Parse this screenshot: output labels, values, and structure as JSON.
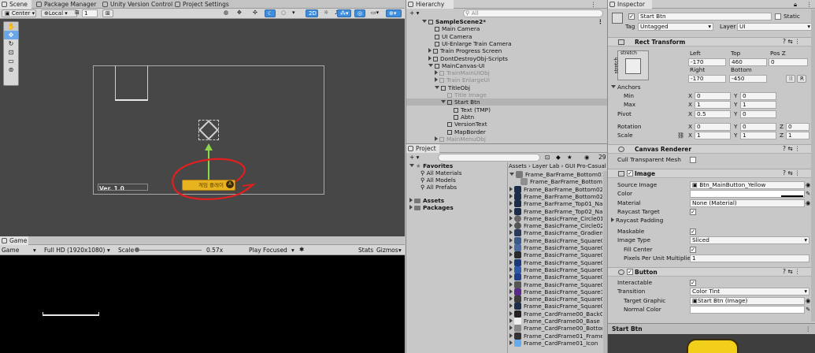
{
  "scene_tabs": {
    "scene": "Scene",
    "package_manager": "Package Manager",
    "unity_version_control": "Unity Version Control",
    "project_settings": "Project Settings"
  },
  "scene_toolbar": {
    "pivot": "Center",
    "space": "Local",
    "snap_value": "1",
    "mode_2d": "2D"
  },
  "scene_view": {
    "version_label": "Ver. 1.0",
    "button_text": "게임 플레이"
  },
  "game_tab": {
    "label": "Game",
    "display": "Game",
    "resolution": "Full HD (1920x1080)",
    "scale_label": "Scale",
    "scale_value": "0.57x",
    "play_mode": "Play Focused",
    "stats": "Stats",
    "gizmos": "Gizmos"
  },
  "hierarchy": {
    "title": "Hierarchy",
    "search_placeholder": "All",
    "items": [
      {
        "label": "SampleScene2*",
        "level": 0,
        "bold": true,
        "arrow": "down",
        "faded": false,
        "selected": false
      },
      {
        "label": "Main Camera",
        "level": 1,
        "arrow": "",
        "faded": false,
        "selected": false
      },
      {
        "label": "UI Camera",
        "level": 1,
        "arrow": "",
        "faded": false,
        "selected": false
      },
      {
        "label": "UI-Enlarge Train Camera",
        "level": 1,
        "arrow": "",
        "faded": false,
        "selected": false
      },
      {
        "label": "Train Progress Screen",
        "level": 1,
        "arrow": "right",
        "faded": false,
        "selected": false
      },
      {
        "label": "DontDestroyObj-Scripts",
        "level": 1,
        "arrow": "right",
        "faded": false,
        "selected": false
      },
      {
        "label": "MainCanvas-UI",
        "level": 1,
        "arrow": "down",
        "faded": false,
        "selected": false
      },
      {
        "label": "TrainMainUIObj",
        "level": 2,
        "arrow": "right",
        "faded": true,
        "selected": false
      },
      {
        "label": "Train EnlargeUI",
        "level": 2,
        "arrow": "right",
        "faded": true,
        "selected": false
      },
      {
        "label": "TitleObj",
        "level": 2,
        "arrow": "down",
        "faded": false,
        "selected": false
      },
      {
        "label": "Title Image",
        "level": 3,
        "arrow": "",
        "faded": true,
        "selected": false
      },
      {
        "label": "Start Btn",
        "level": 3,
        "arrow": "down",
        "faded": false,
        "selected": true
      },
      {
        "label": "Text (TMP)",
        "level": 4,
        "arrow": "",
        "faded": false,
        "selected": false
      },
      {
        "label": "Abtn",
        "level": 4,
        "arrow": "",
        "faded": false,
        "selected": false
      },
      {
        "label": "VersionText",
        "level": 3,
        "arrow": "",
        "faded": false,
        "selected": false
      },
      {
        "label": "MapBorder",
        "level": 3,
        "arrow": "",
        "faded": false,
        "selected": false
      },
      {
        "label": "MainMenuObj",
        "level": 2,
        "arrow": "right",
        "faded": true,
        "selected": false
      }
    ]
  },
  "project": {
    "title": "Project",
    "count": "29",
    "favorites": {
      "label": "Favorites",
      "items": [
        "All Materials",
        "All Models",
        "All Prefabs"
      ]
    },
    "roots": [
      "Assets",
      "Packages"
    ],
    "breadcrumb": [
      "Assets",
      "Layer Lab",
      "GUI Pro-Casual"
    ],
    "files": [
      "Frame_BarFrame_Bottom01_",
      "Frame_BarFrame_BottomC",
      "Frame_BarFrame_Bottom02_",
      "Frame_BarFrame_Bottom02",
      "Frame_BarFrame_Top01_Nav",
      "Frame_BarFrame_Top02_Nav",
      "Frame_BasicFrame_Circle01",
      "Frame_BasicFrame_Circle02",
      "Frame_BasicFrame_Gradient",
      "Frame_BasicFrame_Square0",
      "Frame_BasicFrame_Square0",
      "Frame_BasicFrame_Square0",
      "Frame_BasicFrame_Square0",
      "Frame_BasicFrame_Square0",
      "Frame_BasicFrame_Square0",
      "Frame_BasicFrame_Square0",
      "Frame_BasicFrame_Square1(",
      "Frame_BasicFrame_Square0",
      "Frame_BasicFrame_Square0",
      "Frame_CardFrame00_BackG",
      "Frame_CardFrame00_Base",
      "Frame_CardFrame00_Botton",
      "Frame_CardFrame01_Frame",
      "Frame_CardFrame01_Icon"
    ]
  },
  "inspector": {
    "title": "Inspector",
    "object_name": "Start Btn",
    "static_label": "Static",
    "tag_label": "Tag",
    "tag_value": "Untagged",
    "layer_label": "Layer",
    "layer_value": "UI",
    "rect": {
      "title": "Rect Transform",
      "stretch_top": "stretch",
      "stretch_side": "stretch",
      "left_label": "Left",
      "top_label": "Top",
      "posz_label": "Pos Z",
      "left": "-170",
      "top": "460",
      "posz": "0",
      "right_label": "Right",
      "bottom_label": "Bottom",
      "right": "-170",
      "bottom": "-450",
      "r_btn": "R",
      "anchors": "Anchors",
      "min": "Min",
      "max": "Max",
      "pivot": "Pivot",
      "rotation": "Rotation",
      "scale": "Scale",
      "x": "X",
      "y": "Y",
      "z": "Z",
      "min_x": "0",
      "min_y": "0",
      "max_x": "1",
      "max_y": "1",
      "pivot_x": "0.5",
      "pivot_y": "0",
      "rot_x": "0",
      "rot_y": "0",
      "rot_z": "0",
      "scale_x": "1",
      "scale_y": "1",
      "scale_z": "1"
    },
    "canvas_renderer": {
      "title": "Canvas Renderer",
      "cull": "Cull Transparent Mesh"
    },
    "image": {
      "title": "Image",
      "source_label": "Source Image",
      "source_value": "Btn_MainButton_Yellow",
      "color_label": "Color",
      "material_label": "Material",
      "material_value": "None (Material)",
      "raycast_label": "Raycast Target",
      "raycast_padding": "Raycast Padding",
      "maskable": "Maskable",
      "image_type_label": "Image Type",
      "image_type": "Sliced",
      "fill_center": "Fill Center",
      "ppu_label": "Pixels Per Unit Multiplier",
      "ppu_value": "1"
    },
    "button": {
      "title": "Button",
      "interactable": "Interactable",
      "transition_label": "Transition",
      "transition_value": "Color Tint",
      "target_label": "Target Graphic",
      "target_value": "Start Btn (Image)",
      "normal_label": "Normal Color"
    },
    "preview_title": "Start Btn"
  },
  "colors": {
    "scene_bg": "#474747",
    "game_bg": "#000000",
    "selection": "#bcbcbc",
    "button_yellow": "#e7b420",
    "annotation_red": "#e11f1f",
    "gizmo_green": "#8cd64a"
  }
}
